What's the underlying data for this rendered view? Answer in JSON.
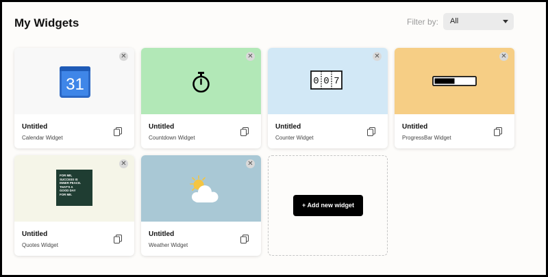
{
  "header": {
    "title": "My Widgets",
    "filter_label": "Filter by:",
    "filter_value": "All"
  },
  "widgets": [
    {
      "title": "Untitled",
      "subtitle": "Calendar Widget",
      "thumb_color": "#f8f8f8",
      "icon": "calendar-icon",
      "calendar_day": "31"
    },
    {
      "title": "Untitled",
      "subtitle": "Countdown Widget",
      "thumb_color": "#b2e8b7",
      "icon": "stopwatch-icon"
    },
    {
      "title": "Untitled",
      "subtitle": "Counter Widget",
      "thumb_color": "#d2e8f6",
      "icon": "counter-icon",
      "counter_digits": [
        "0",
        "0",
        "7"
      ]
    },
    {
      "title": "Untitled",
      "subtitle": "ProgressBar Widget",
      "thumb_color": "#f6ce85",
      "icon": "progress-bar-icon",
      "progress": 0.5
    },
    {
      "title": "Untitled",
      "subtitle": "Quotes Widget",
      "thumb_color": "#f5f5e8",
      "icon": "quote-card-icon",
      "quote_lines": [
        "FOR ME,",
        "SUCCESS IS",
        "INNER PEACE.",
        "THAT'S A",
        "GOOD DAY",
        "FOR ME."
      ]
    },
    {
      "title": "Untitled",
      "subtitle": "Weather Widget",
      "thumb_color": "#a9c8d5",
      "icon": "sun-cloud-icon"
    }
  ],
  "add_widget_label": "+ Add new widget",
  "colors": {
    "accent": "#000000",
    "page_bg": "#fdfcfa"
  }
}
